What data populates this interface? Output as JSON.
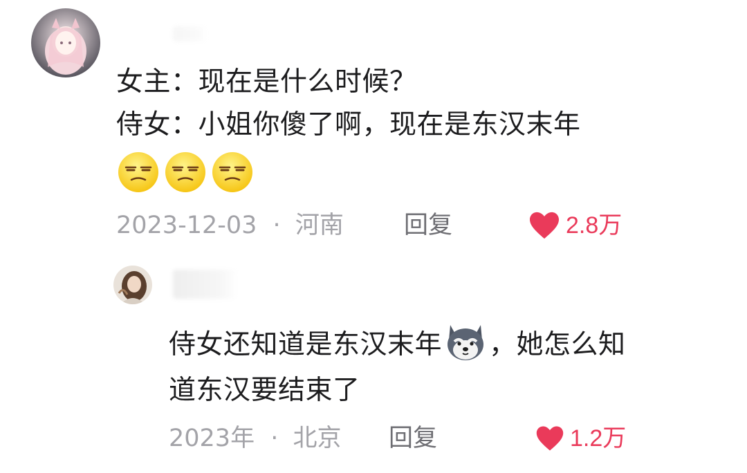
{
  "comment1": {
    "line1": "女主：现在是什么时候？",
    "line2": "侍女：小姐你傻了啊，现在是东汉末年",
    "emoji": "smirk-emoji",
    "date": "2023-12-03",
    "separator": "·",
    "location": "河南",
    "reply_label": "回复",
    "likes": "2.8万"
  },
  "comment2": {
    "line1_before": "侍女还知道是东汉末年",
    "line1_after": "，她怎么知",
    "line2": "道东汉要结束了",
    "emoji": "husky-dog-emoji",
    "date": "2023年",
    "separator": "·",
    "location": "北京",
    "reply_label": "回复",
    "likes": "1.2万"
  },
  "colors": {
    "like": "#ea3a5a",
    "meta": "#a3a3a8",
    "text": "#1c1c1e"
  }
}
